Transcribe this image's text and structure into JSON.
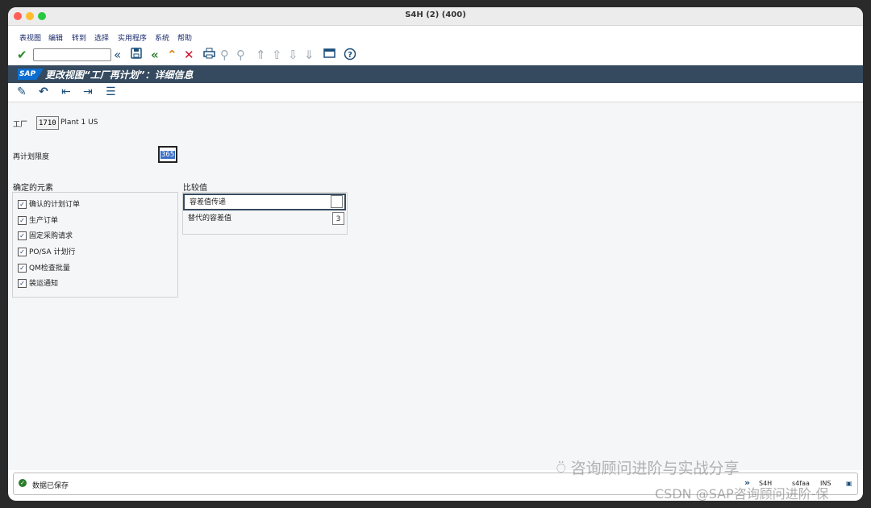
{
  "window": {
    "title": "S4H (2) (400)"
  },
  "menu": [
    "表视图",
    "编辑",
    "转到",
    "选择",
    "实用程序",
    "系统",
    "帮助"
  ],
  "toolbar": {
    "command_value": "",
    "icons": [
      "checkmark-icon",
      "back-double-icon",
      "save-icon",
      "back-icon",
      "exit-icon",
      "cancel-icon",
      "print-icon",
      "find-icon",
      "find-next-icon",
      "first-page-icon",
      "previous-page-icon",
      "next-page-icon",
      "last-page-icon",
      "layout-icon",
      "help-icon"
    ]
  },
  "header": {
    "logo_text": "SAP",
    "title": "更改视图“工厂再计划”：详细信息"
  },
  "app_toolbar": {
    "icons": [
      "display-change-icon",
      "undo-icon",
      "previous-entry-icon",
      "next-entry-icon",
      "variable-list-icon"
    ]
  },
  "form": {
    "plant_label": "工厂",
    "plant_value": "1710",
    "plant_name": "Plant 1 US",
    "limit_label": "再计划限度",
    "limit_value": "365"
  },
  "groups": {
    "fixed_elements": {
      "title": "确定的元素",
      "items": [
        {
          "label": "确认的计划订单",
          "checked": true
        },
        {
          "label": "生产订单",
          "checked": true
        },
        {
          "label": "固定采购请求",
          "checked": true
        },
        {
          "label": "PO/SA 计划行",
          "checked": true
        },
        {
          "label": "QM检查批量",
          "checked": true
        },
        {
          "label": "装运通知",
          "checked": true
        }
      ]
    },
    "comparison": {
      "title": "比较值",
      "rows": [
        {
          "label": "容差值传递",
          "value": ""
        },
        {
          "label": "替代的容差值",
          "value": "3"
        }
      ]
    }
  },
  "status": {
    "message": "数据已保存",
    "system": "S4H",
    "server": "s4faa",
    "mode": "INS"
  },
  "watermarks": {
    "line1": "咨询顾问进阶与实战分享",
    "line2": "CSDN @SAP咨询顾问进阶-保"
  },
  "colors": {
    "header_bg": "#354a5f",
    "accent": "#0a6ed1",
    "ok_green": "#2b7d2b"
  }
}
